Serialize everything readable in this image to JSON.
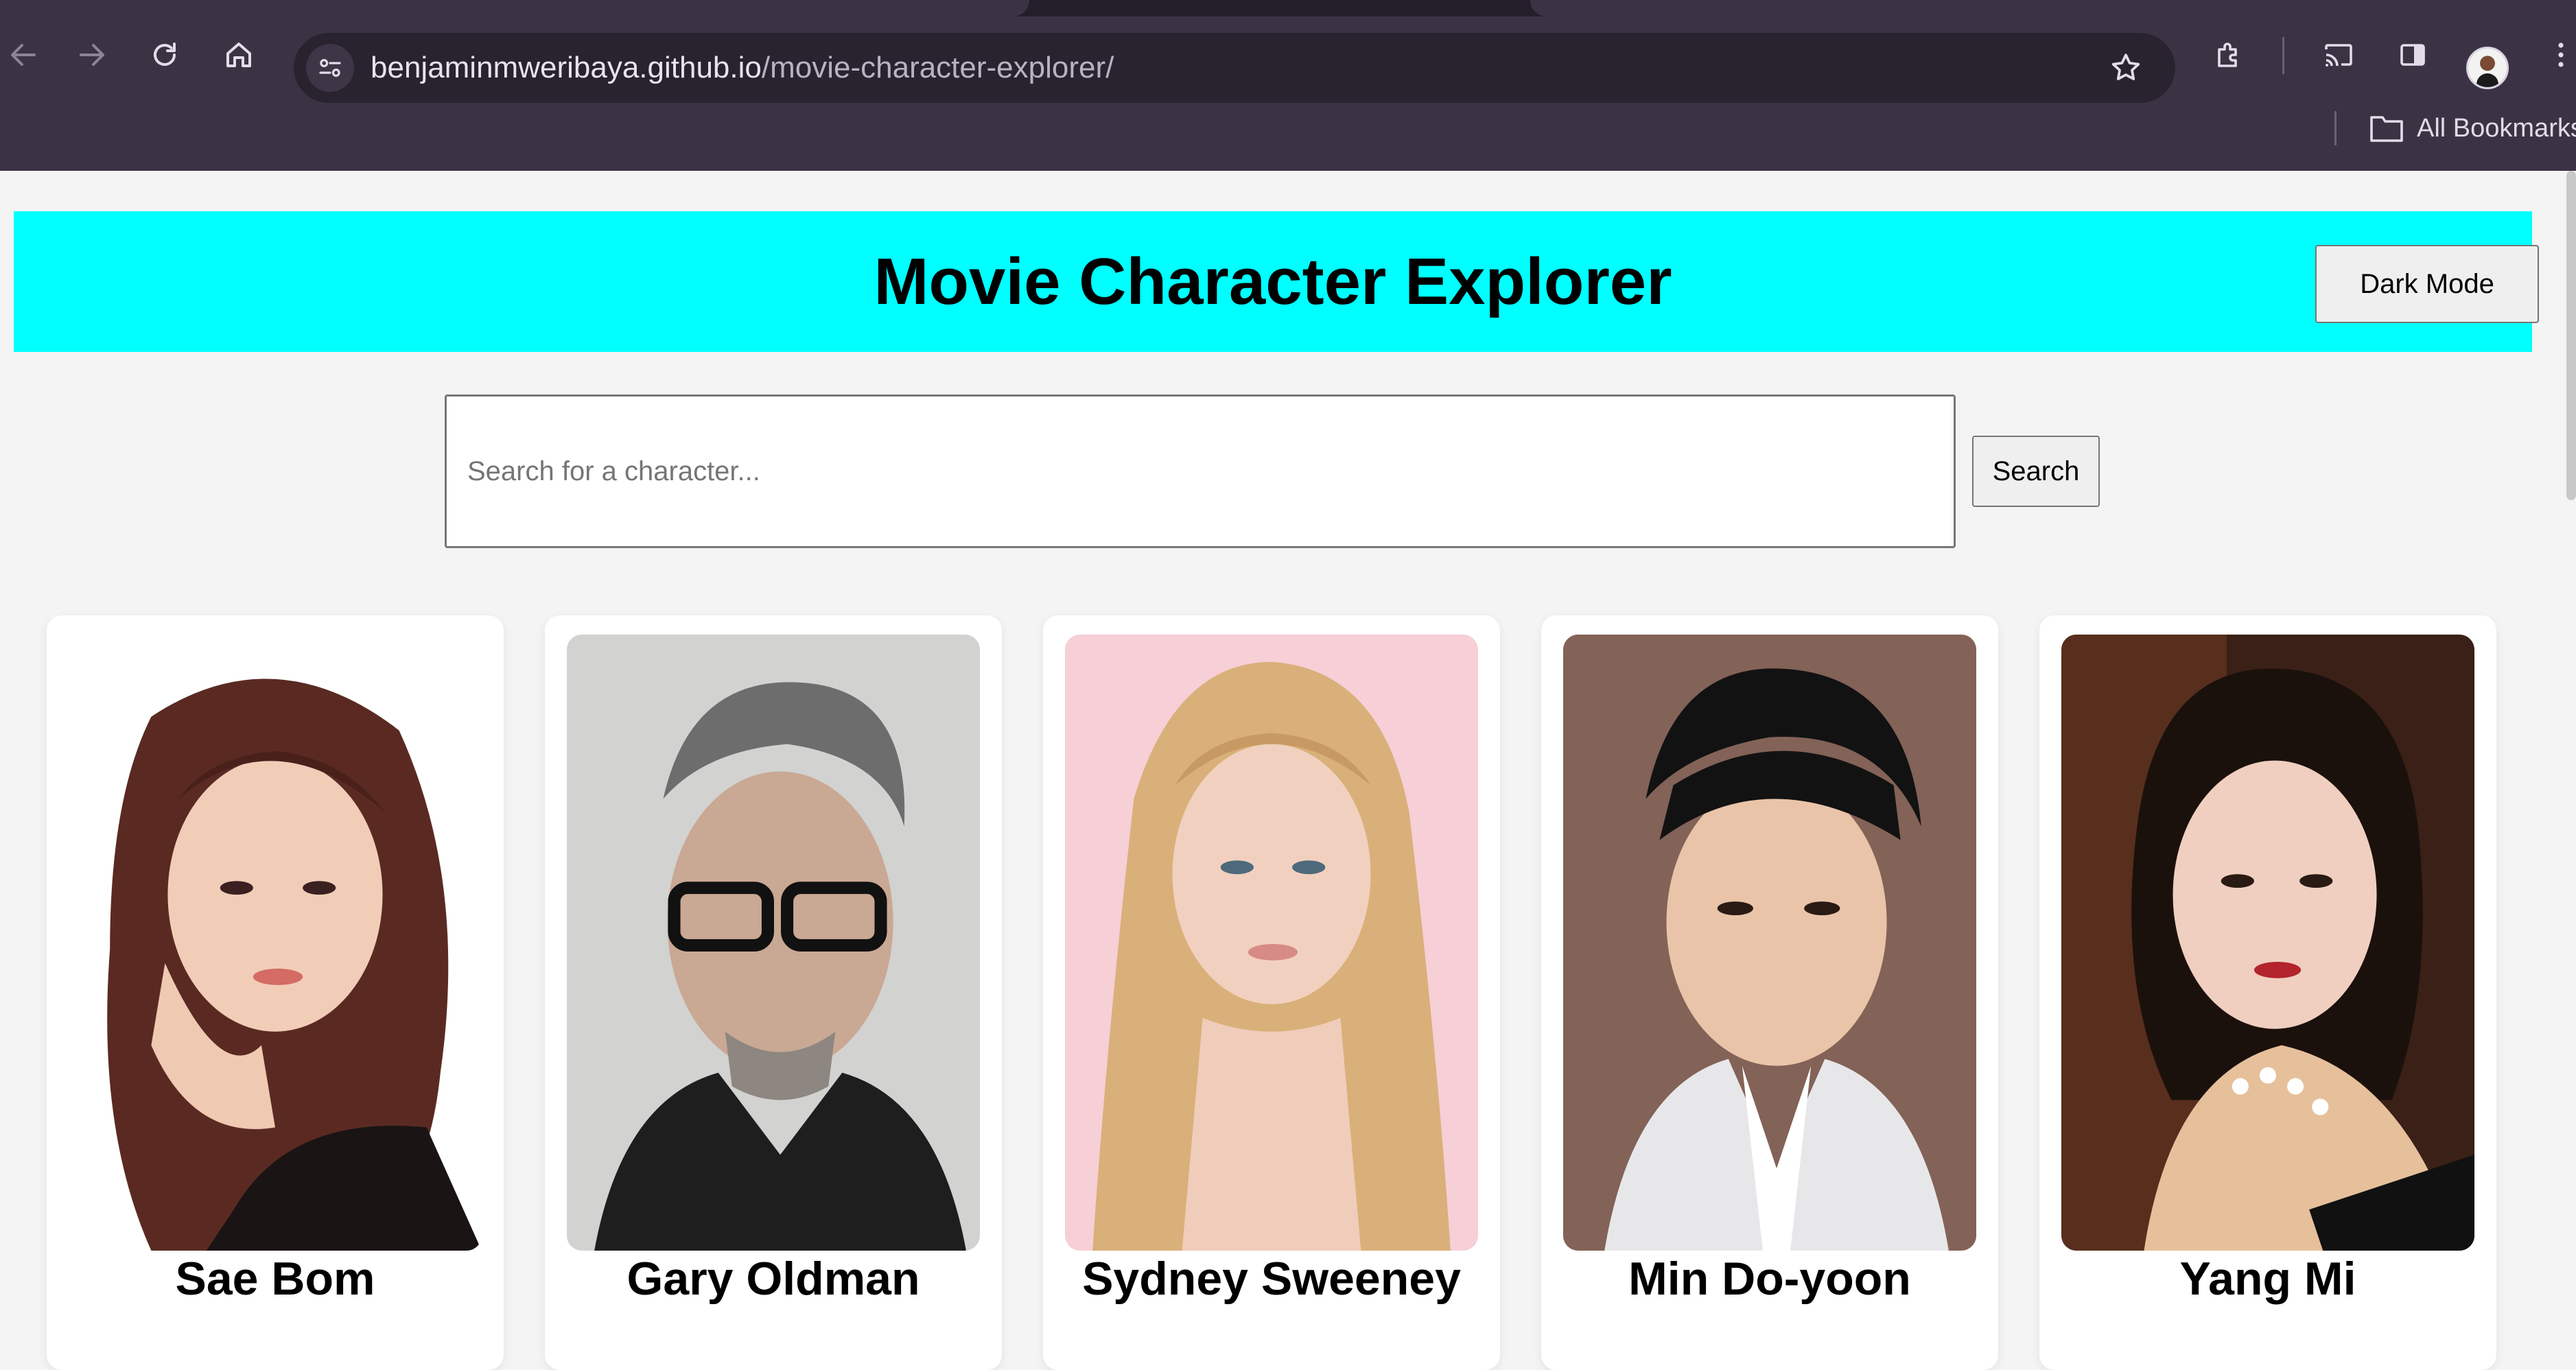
{
  "browser": {
    "url_domain": "benjaminmweribaya.github.io",
    "url_path": "/movie-character-explorer/",
    "bookmarks_label": "All Bookmarks",
    "icons": [
      "back-icon",
      "forward-icon",
      "reload-icon",
      "home-icon",
      "site-info-icon",
      "bookmark-star-icon",
      "extensions-icon",
      "cast-icon",
      "side-panel-icon",
      "profile-avatar",
      "more-menu-icon",
      "folder-icon"
    ]
  },
  "header": {
    "title": "Movie Character Explorer",
    "dark_mode_label": "Dark Mode",
    "background_color": "#00ffff"
  },
  "search": {
    "placeholder": "Search for a character...",
    "value": "",
    "button_label": "Search"
  },
  "characters": [
    {
      "name": "Sae Bom"
    },
    {
      "name": "Gary Oldman"
    },
    {
      "name": "Sydney Sweeney"
    },
    {
      "name": "Min Do-yoon"
    },
    {
      "name": "Yang Mi"
    }
  ]
}
